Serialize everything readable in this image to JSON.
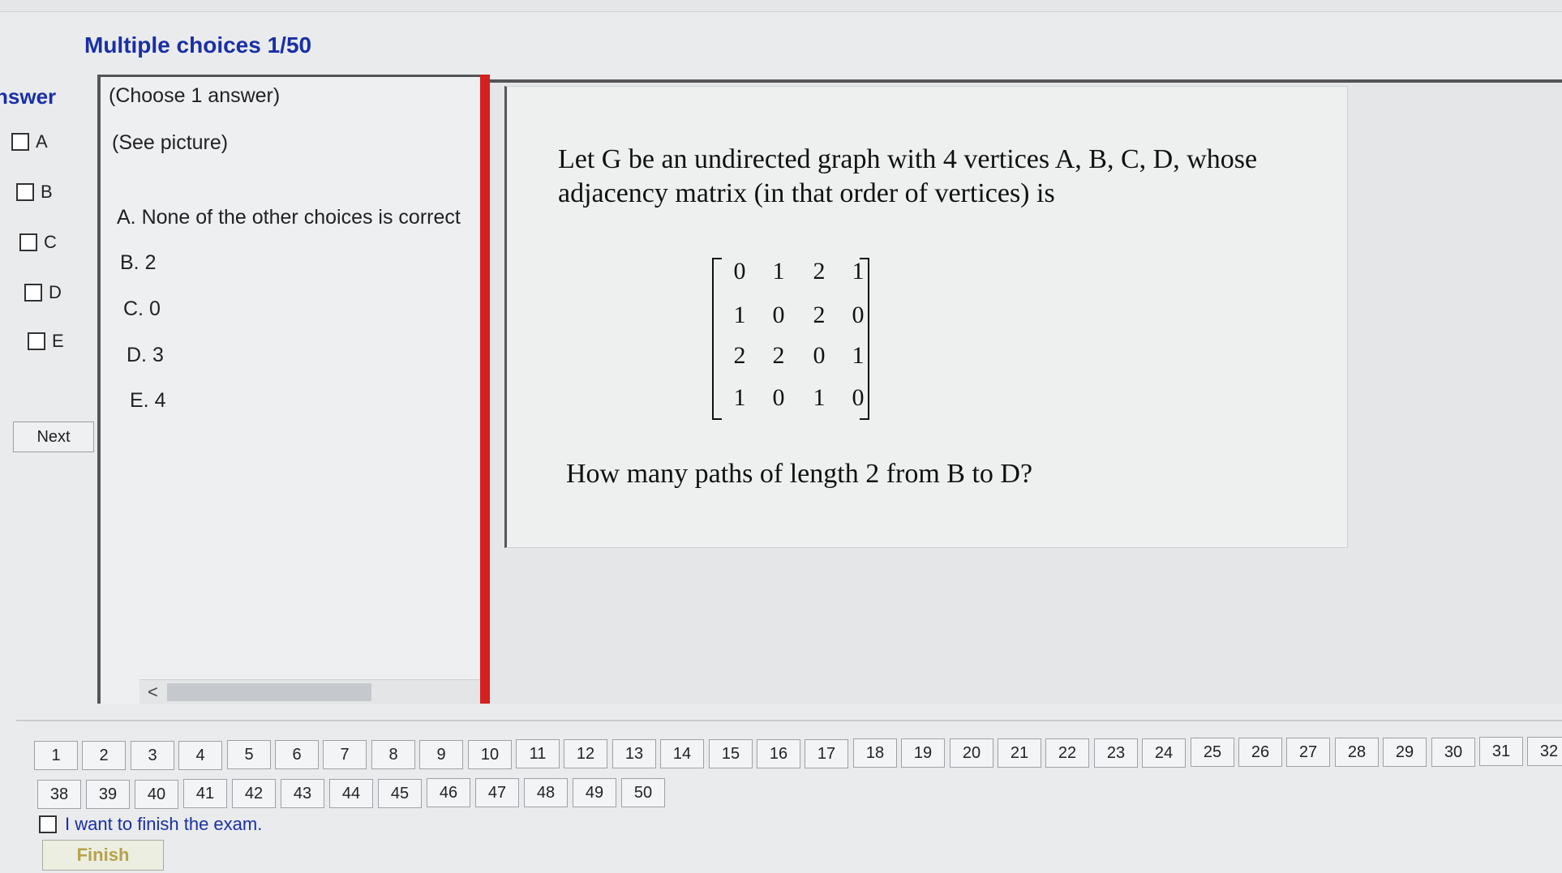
{
  "header": {
    "title": "Multiple choices 1/50"
  },
  "answer_panel": {
    "heading": "nswer",
    "options": [
      "A",
      "B",
      "C",
      "D",
      "E"
    ],
    "next_label": "Next"
  },
  "choices": {
    "instruction": "(Choose 1 answer)",
    "see_picture": "(See picture)",
    "items": [
      "A. None of the other choices is correct",
      "B. 2",
      "C. 0",
      "D. 3",
      "E. 4"
    ],
    "scroll_left": "<",
    "scroll_right": ">"
  },
  "question": {
    "line1": "Let G be an undirected graph with 4 vertices A, B, C, D, whose",
    "line2": "adjacency matrix (in that order of vertices) is",
    "matrix": [
      [
        "0",
        "1",
        "2",
        "1"
      ],
      [
        "1",
        "0",
        "2",
        "0"
      ],
      [
        "2",
        "2",
        "0",
        "1"
      ],
      [
        "1",
        "0",
        "1",
        "0"
      ]
    ],
    "prompt": "How many paths of length 2 from B to D?"
  },
  "navigation": {
    "row1": [
      "1",
      "2",
      "3",
      "4",
      "5",
      "6",
      "7",
      "8",
      "9",
      "10",
      "11",
      "12",
      "13",
      "14",
      "15",
      "16",
      "17",
      "18",
      "19",
      "20",
      "21",
      "22",
      "23",
      "24",
      "25",
      "26",
      "27",
      "28",
      "29",
      "30",
      "31",
      "32"
    ],
    "row2": [
      "38",
      "39",
      "40",
      "41",
      "42",
      "43",
      "44",
      "45",
      "46",
      "47",
      "48",
      "49",
      "50"
    ]
  },
  "finish": {
    "checkbox_label": "I want to finish the exam.",
    "button_label": "Finish"
  }
}
